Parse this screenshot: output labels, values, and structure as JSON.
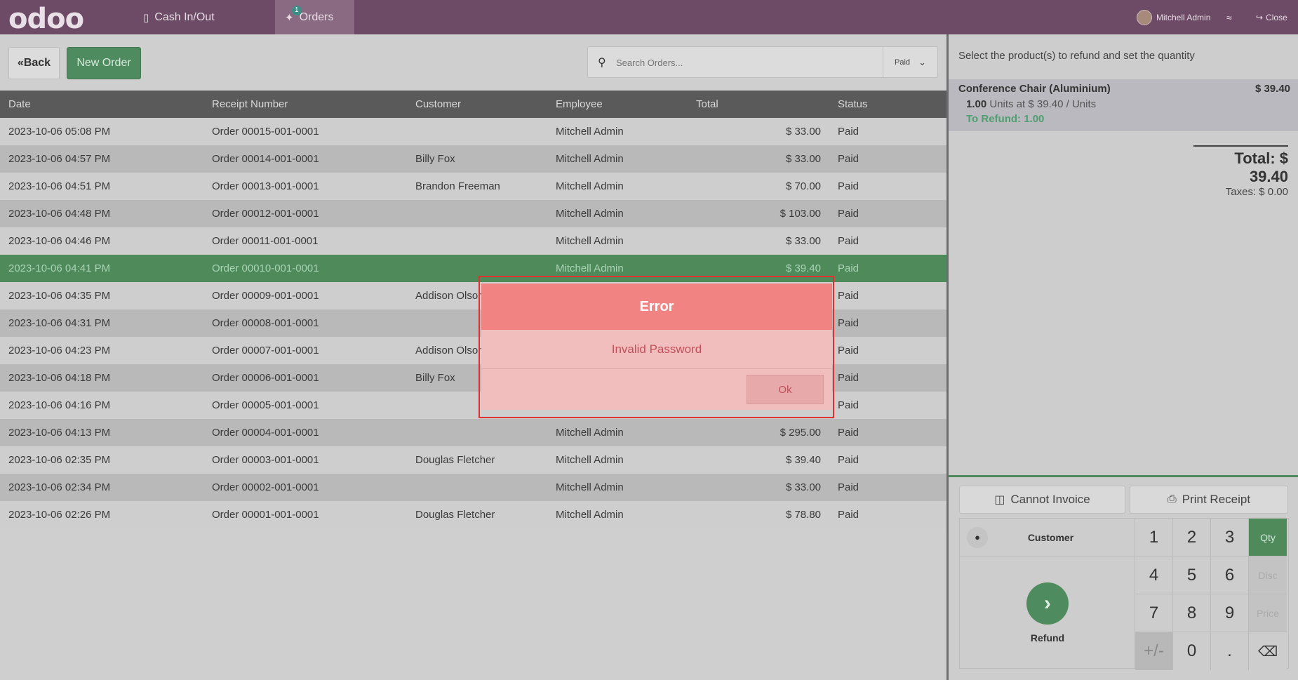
{
  "topbar": {
    "logo": "odoo",
    "nav": [
      {
        "label": "Cash In/Out",
        "icon": "money-icon"
      },
      {
        "label": "Orders",
        "icon": "tag-icon",
        "badge": "1"
      }
    ],
    "user": "Mitchell Admin",
    "close_label": "Close"
  },
  "controls": {
    "back_label": "Back",
    "new_order_label": "New Order",
    "search_placeholder": "Search Orders...",
    "filter_label": "Paid"
  },
  "table": {
    "headers": [
      "Date",
      "Receipt Number",
      "Customer",
      "Employee",
      "Total",
      "Status"
    ],
    "rows": [
      {
        "date": "2023-10-06 05:08 PM",
        "receipt": "Order 00015-001-0001",
        "customer": "",
        "employee": "Mitchell Admin",
        "total": "$ 33.00",
        "status": "Paid"
      },
      {
        "date": "2023-10-06 04:57 PM",
        "receipt": "Order 00014-001-0001",
        "customer": "Billy Fox",
        "employee": "Mitchell Admin",
        "total": "$ 33.00",
        "status": "Paid"
      },
      {
        "date": "2023-10-06 04:51 PM",
        "receipt": "Order 00013-001-0001",
        "customer": "Brandon Freeman",
        "employee": "Mitchell Admin",
        "total": "$ 70.00",
        "status": "Paid"
      },
      {
        "date": "2023-10-06 04:48 PM",
        "receipt": "Order 00012-001-0001",
        "customer": "",
        "employee": "Mitchell Admin",
        "total": "$ 103.00",
        "status": "Paid"
      },
      {
        "date": "2023-10-06 04:46 PM",
        "receipt": "Order 00011-001-0001",
        "customer": "",
        "employee": "Mitchell Admin",
        "total": "$ 33.00",
        "status": "Paid"
      },
      {
        "date": "2023-10-06 04:41 PM",
        "receipt": "Order 00010-001-0001",
        "customer": "",
        "employee": "Mitchell Admin",
        "total": "$ 39.40",
        "status": "Paid",
        "selected": true
      },
      {
        "date": "2023-10-06 04:35 PM",
        "receipt": "Order 00009-001-0001",
        "customer": "Addison Olson",
        "employee": "",
        "total": "",
        "status": "Paid"
      },
      {
        "date": "2023-10-06 04:31 PM",
        "receipt": "Order 00008-001-0001",
        "customer": "",
        "employee": "",
        "total": "",
        "status": "Paid"
      },
      {
        "date": "2023-10-06 04:23 PM",
        "receipt": "Order 00007-001-0001",
        "customer": "Addison Olson",
        "employee": "",
        "total": "",
        "status": "Paid"
      },
      {
        "date": "2023-10-06 04:18 PM",
        "receipt": "Order 00006-001-0001",
        "customer": "Billy Fox",
        "employee": "",
        "total": "",
        "status": "Paid"
      },
      {
        "date": "2023-10-06 04:16 PM",
        "receipt": "Order 00005-001-0001",
        "customer": "",
        "employee": "",
        "total": "",
        "status": "Paid"
      },
      {
        "date": "2023-10-06 04:13 PM",
        "receipt": "Order 00004-001-0001",
        "customer": "",
        "employee": "Mitchell Admin",
        "total": "$ 295.00",
        "status": "Paid"
      },
      {
        "date": "2023-10-06 02:35 PM",
        "receipt": "Order 00003-001-0001",
        "customer": "Douglas Fletcher",
        "employee": "Mitchell Admin",
        "total": "$ 39.40",
        "status": "Paid"
      },
      {
        "date": "2023-10-06 02:34 PM",
        "receipt": "Order 00002-001-0001",
        "customer": "",
        "employee": "Mitchell Admin",
        "total": "$ 33.00",
        "status": "Paid"
      },
      {
        "date": "2023-10-06 02:26 PM",
        "receipt": "Order 00001-001-0001",
        "customer": "Douglas Fletcher",
        "employee": "Mitchell Admin",
        "total": "$ 78.80",
        "status": "Paid"
      }
    ]
  },
  "refund": {
    "hint": "Select the product(s) to refund and set the quantity",
    "line": {
      "product": "Conference Chair (Aluminium)",
      "price": "$ 39.40",
      "qty": "1.00",
      "qty_suffix": "Units at $ 39.40 / Units",
      "to_refund": "To Refund: 1.00"
    },
    "total": "Total: $ 39.40",
    "taxes": "Taxes: $ 0.00",
    "invoice_label": "Cannot Invoice",
    "print_label": "Print Receipt",
    "customer_label": "Customer",
    "pay_label": "Refund",
    "keys": [
      "1",
      "2",
      "3",
      "Qty",
      "4",
      "5",
      "6",
      "Disc",
      "7",
      "8",
      "9",
      "Price",
      "+/-",
      "0",
      ".",
      "⌫"
    ]
  },
  "dialog": {
    "title": "Error",
    "message": "Invalid Password",
    "ok_label": "Ok"
  },
  "colors": {
    "topbar": "#6d4a66",
    "accent_green": "#4f8a5b",
    "dialog_header": "#f28383",
    "dialog_body": "#f2bdbd"
  }
}
